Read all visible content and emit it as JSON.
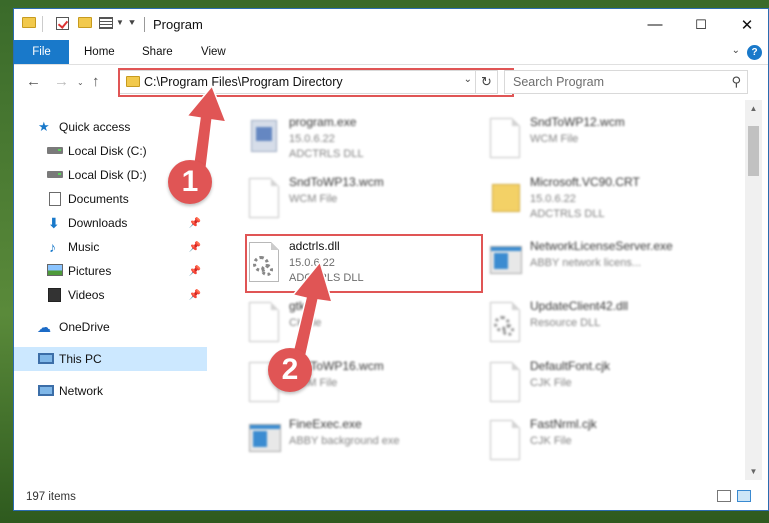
{
  "window": {
    "title": "Program",
    "minimize_glyph": "—",
    "maximize_glyph": "☐",
    "close_glyph": "✕"
  },
  "ribbon": {
    "tabs": [
      "File",
      "Home",
      "Share",
      "View"
    ]
  },
  "address_bar": {
    "path": "C:\\Program Files\\Program Directory",
    "search_placeholder": "Search Program"
  },
  "navigation": {
    "items": [
      {
        "label": "Quick access",
        "icon": "star-icon",
        "pinned": false
      },
      {
        "label": "Local Disk (C:)",
        "icon": "disk-icon",
        "pinned": false
      },
      {
        "label": "Local Disk (D:)",
        "icon": "disk-icon",
        "pinned": false
      },
      {
        "label": "Documents",
        "icon": "documents-icon",
        "pinned": false
      },
      {
        "label": "Downloads",
        "icon": "download-icon",
        "pinned": true
      },
      {
        "label": "Music",
        "icon": "music-icon",
        "pinned": true
      },
      {
        "label": "Pictures",
        "icon": "pictures-icon",
        "pinned": true
      },
      {
        "label": "Videos",
        "icon": "videos-icon",
        "pinned": true
      },
      {
        "label": "OneDrive",
        "icon": "onedrive-icon",
        "pinned": false
      },
      {
        "label": "This PC",
        "icon": "this-pc-icon",
        "pinned": false,
        "selected": true
      },
      {
        "label": "Network",
        "icon": "network-icon",
        "pinned": false
      }
    ]
  },
  "files": [
    {
      "name": "program.exe",
      "line1": "15.0.6.22",
      "line2": "ADCTRLS DLL",
      "icon": "program-icon",
      "blurred": true
    },
    {
      "name": "SndToWP12.wcm",
      "line1": "WCM File",
      "line2": "",
      "icon": "page-icon",
      "blurred": true
    },
    {
      "name": "SndToWP13.wcm",
      "line1": "WCM File",
      "line2": "",
      "icon": "page-icon",
      "blurred": true
    },
    {
      "name": "Microsoft.VC90.CRT",
      "line1": "15.0.6.22",
      "line2": "ADCTRLS DLL",
      "icon": "folder-icon",
      "blurred": true
    },
    {
      "name": "adctrls.dll",
      "line1": "15.0.6.22",
      "line2": "ADCTRLS DLL",
      "icon": "dll-gear-icon",
      "blurred": false
    },
    {
      "name": "NetworkLicenseServer.exe",
      "line1": "ABBY network licens...",
      "line2": "",
      "icon": "exe-icon",
      "blurred": true
    },
    {
      "name": "gtk",
      "line1": "CK file",
      "line2": "",
      "icon": "page-icon",
      "blurred": true
    },
    {
      "name": "UpdateClient42.dll",
      "line1": "Resource DLL",
      "line2": "",
      "icon": "dll-gear-icon",
      "blurred": true
    },
    {
      "name": "SndToWP16.wcm",
      "line1": "WCM File",
      "line2": "",
      "icon": "page-icon",
      "blurred": true
    },
    {
      "name": "DefaultFont.cjk",
      "line1": "CJK File",
      "line2": "",
      "icon": "page-icon",
      "blurred": true
    },
    {
      "name": "FineExec.exe",
      "line1": "ABBY background exe",
      "line2": "",
      "icon": "exe-icon",
      "blurred": true
    },
    {
      "name": "FastNrml.cjk",
      "line1": "CJK File",
      "line2": "",
      "icon": "page-icon",
      "blurred": true
    }
  ],
  "status": {
    "item_count": "197 items"
  },
  "callouts": [
    "1",
    "2"
  ],
  "colors": {
    "accent": "#1979ca",
    "highlight": "#e05555",
    "selected_nav": "#cce8ff"
  }
}
